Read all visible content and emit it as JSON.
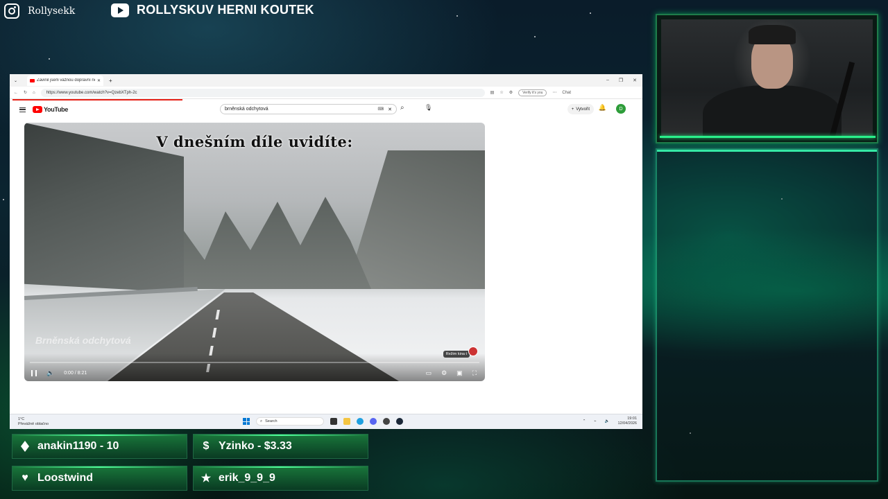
{
  "overlay": {
    "instagram_name": "Rollysekk",
    "channel_title": "ROLLYSKUV HERNI KOUTEK"
  },
  "browser": {
    "tab_title": "Zavinil jsem vážnou dopravní neh",
    "url": "https://www.youtube.com/watch?v=QzebXTph-2c",
    "verify_label": "Verify it's you",
    "chat_label": "Chat"
  },
  "youtube": {
    "logo_text": "YouTube",
    "search_value": "brněnská odchytová",
    "create_label": "Vytvořit",
    "avatar_letter": "D"
  },
  "player": {
    "overlay_title": "V dnešním díle uvidíte:",
    "watermark": "Brněnská odchytová",
    "time": "0:00 / 8:21",
    "tooltip": "Režim kina",
    "tooltip_key": "t",
    "progress": 0.0
  },
  "taskbar": {
    "weather_temp": "1°C",
    "weather_desc": "Převážně oblačno",
    "search_placeholder": "Search",
    "time": "19:01",
    "date": "12/04/2026"
  },
  "events": {
    "top_bits": "anakin1190 - 10",
    "top_tip": "Yzinko - $3.33",
    "latest_follower": "Loostwind",
    "latest_sub": "erik_9_9_9"
  },
  "colors": {
    "accent_green": "#2af08a",
    "youtube_red": "#ff0000"
  }
}
